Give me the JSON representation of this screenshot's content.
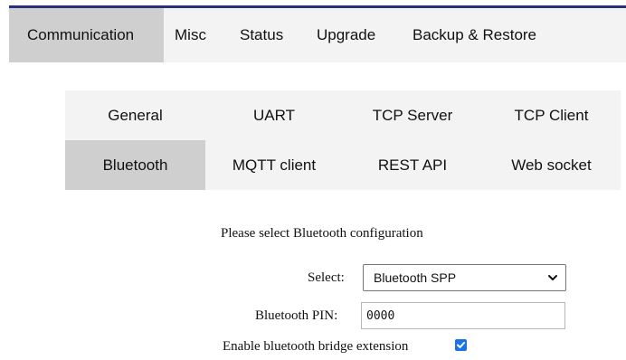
{
  "main_tabs": [
    "Communication",
    "Misc",
    "Status",
    "Upgrade",
    "Backup & Restore"
  ],
  "sub_tabs": [
    "General",
    "UART",
    "TCP Server",
    "TCP Client",
    "Bluetooth",
    "MQTT client",
    "REST API",
    "Web socket"
  ],
  "form": {
    "title": "Please select Bluetooth configuration",
    "select_label": "Select:",
    "select_value": "Bluetooth SPP",
    "pin_label": "Bluetooth PIN:",
    "pin_value": "0000",
    "bridge_label": "Enable bluetooth bridge extension",
    "bridge_checked": true
  },
  "colors": {
    "top_rule": "#2a2f7a",
    "active_tab": "#cfcfcf",
    "tab_bar": "#f3f3f3",
    "checkbox": "#1a73e8"
  },
  "icons": {
    "select_arrow": "chevron-down-icon",
    "checkbox_mark": "check-icon"
  }
}
